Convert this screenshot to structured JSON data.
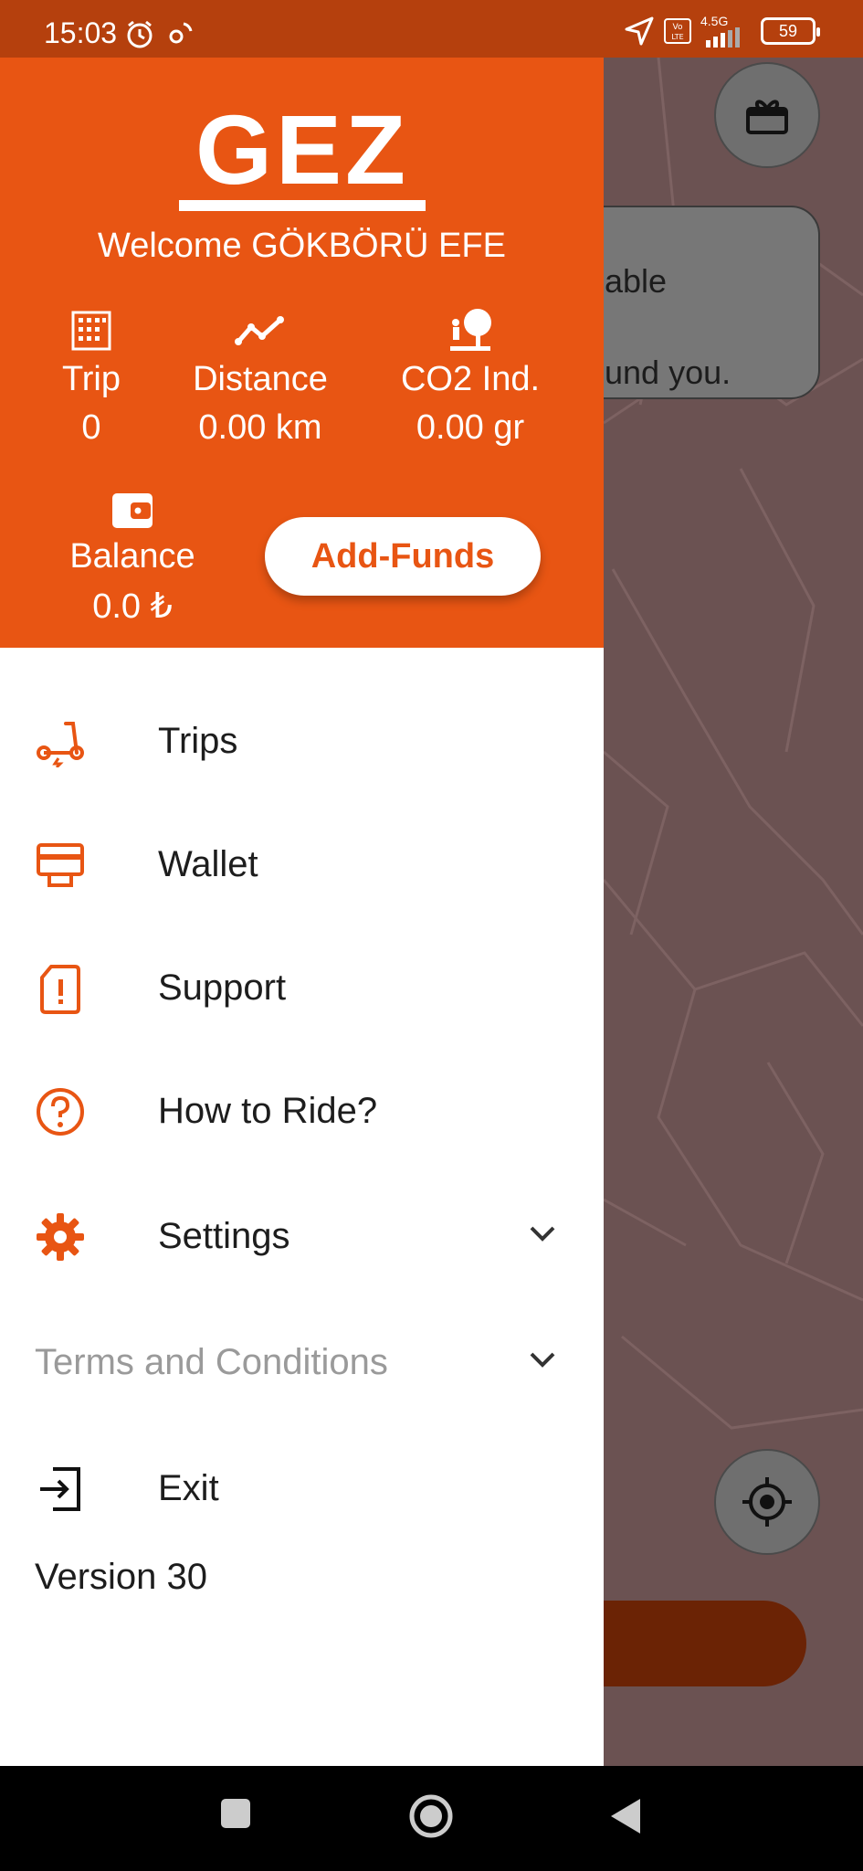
{
  "status_bar": {
    "time": "15:03",
    "network": "4.5G",
    "lte_badge": "Vo LTE",
    "battery": "59"
  },
  "map": {
    "tip_line1": "able",
    "tip_line2": "und you."
  },
  "header": {
    "logo_text": "GEZ",
    "welcome": "Welcome GÖKBÖRÜ EFE",
    "stats": {
      "trip_label": "Trip",
      "trip_value": "0",
      "distance_label": "Distance",
      "distance_value": "0.00 km",
      "co2_label": "CO2 Ind.",
      "co2_value": "0.00 gr",
      "balance_label": "Balance",
      "balance_value": "0.0 ₺"
    },
    "add_funds": "Add-Funds"
  },
  "menu": {
    "items": [
      {
        "label": "Trips"
      },
      {
        "label": "Wallet"
      },
      {
        "label": "Support"
      },
      {
        "label": "How to Ride?"
      },
      {
        "label": "Settings"
      },
      {
        "label": "Terms and Conditions"
      },
      {
        "label": "Exit"
      }
    ],
    "version": "Version 30"
  },
  "colors": {
    "accent": "#e85513",
    "status_bar": "#b5400d",
    "map": "#6b5252"
  }
}
